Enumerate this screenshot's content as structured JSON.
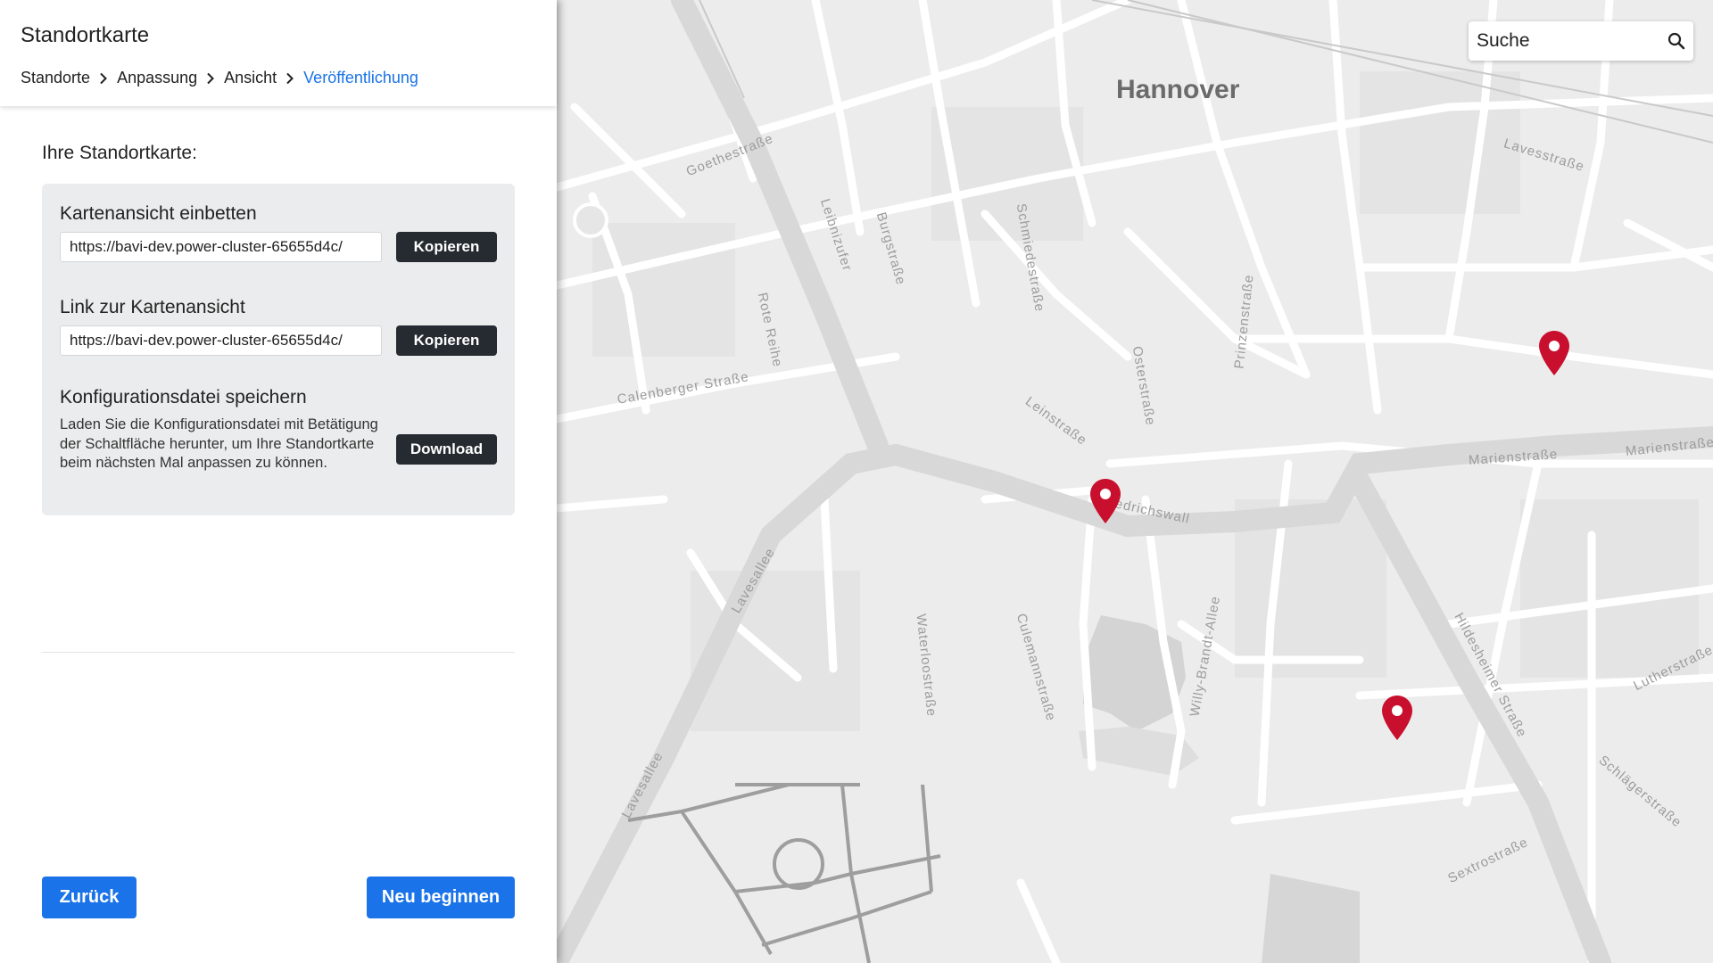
{
  "app": {
    "title": "Standortkarte"
  },
  "breadcrumb": [
    {
      "label": "Standorte",
      "active": false
    },
    {
      "label": "Anpassung",
      "active": false
    },
    {
      "label": "Ansicht",
      "active": false
    },
    {
      "label": "Veröffentlichung",
      "active": true
    }
  ],
  "content": {
    "section_title": "Ihre Standortkarte:",
    "embed": {
      "title": "Kartenansicht einbetten",
      "url": "https://bavi-dev.power-cluster-65655d4c/",
      "button": "Kopieren"
    },
    "link": {
      "title": "Link zur Kartenansicht",
      "url": "https://bavi-dev.power-cluster-65655d4c/",
      "button": "Kopieren"
    },
    "config": {
      "title": "Konfigurationsdatei speichern",
      "description": "Laden Sie die Konfigurationsdatei mit Betätigung der Schaltfläche herunter, um Ihre Standortkarte beim nächsten Mal anpassen zu können.",
      "button": "Download"
    }
  },
  "footer": {
    "back_label": "Zurück",
    "restart_label": "Neu beginnen"
  },
  "map": {
    "search_placeholder": "Suche",
    "city_label": "Hannover",
    "street_labels": {
      "goethestrasse": "Goethestraße",
      "leibnizufer": "Leibnizufer",
      "burgstrasse": "Burgstraße",
      "schmiedestrasse": "Schmiedestraße",
      "rote_reihe": "Rote Reihe",
      "calenberger": "Calenberger Straße",
      "leinstrasse": "Leinstraße",
      "osterstrasse": "Osterstraße",
      "prinzenstrasse": "Prinzenstraße",
      "lavesstrasse": "Lavesstraße",
      "friedrichswall": "Friedrichswall",
      "marienstrasse_1": "Marienstraße",
      "marienstrasse_2": "Marienstraße",
      "lavesallee_1": "Lavesallee",
      "lavesallee_2": "Lavesallee",
      "waterloostrasse": "Waterloostraße",
      "culemannstrasse": "Culemannstraße",
      "willy_brandt": "Willy-Brandt-Allee",
      "hildesheimer": "Hildesheimer Straße",
      "lutherstrasse": "Lutherstraße",
      "schlaegerstrasse": "Schlägerstraße",
      "sextrostrasse": "Sextrostraße"
    },
    "marker_color": "#c8102e",
    "marker_count": 3
  },
  "colors": {
    "accent": "#1a73e8",
    "dark_button": "#252b30",
    "card_background": "#ebeced"
  }
}
